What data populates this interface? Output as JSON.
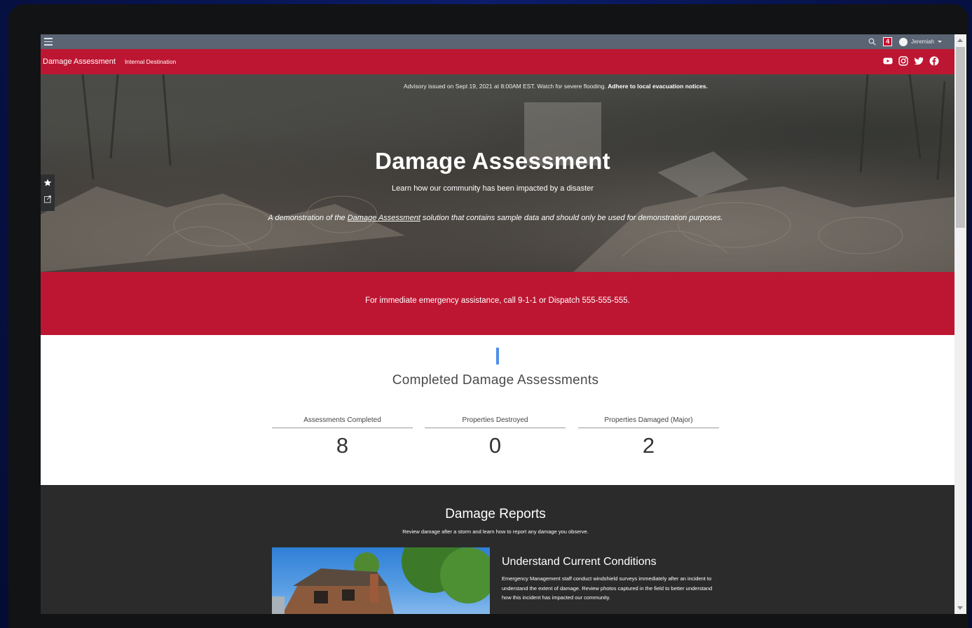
{
  "system_bar": {
    "notification_count": "4",
    "user_name": "Jeremiah"
  },
  "site_header": {
    "title": "Damage Assessment",
    "nav_link": "Internal Destination",
    "social_icons": [
      "youtube-icon",
      "instagram-icon",
      "twitter-icon",
      "facebook-icon"
    ]
  },
  "hero": {
    "advisory_text": "Advisory issued on Sept 19, 2021 at 8:00AM EST. Watch for severe flooding. ",
    "advisory_bold": "Adhere to local evacuation notices.",
    "title": "Damage Assessment",
    "subtitle": "Learn how our community has been impacted by a disaster",
    "demo_prefix": "A demonstration of the ",
    "demo_link": "Damage Assessment",
    "demo_suffix": " solution that contains sample data and should only be used for demonstration purposes."
  },
  "emergency": {
    "text": "For immediate emergency assistance, call 9-1-1 or Dispatch 555-555-555."
  },
  "stats": {
    "title": "Completed Damage Assessments",
    "items": [
      {
        "label": "Assessments Completed",
        "value": "8"
      },
      {
        "label": "Properties Destroyed",
        "value": "0"
      },
      {
        "label": "Properties Damaged (Major)",
        "value": "2"
      }
    ]
  },
  "reports": {
    "title": "Damage Reports",
    "subtitle": "Review damage after a storm and learn how to report any damage you observe.",
    "card_title": "Understand Current Conditions",
    "card_body": "Emergency Management staff conduct windshield surveys immediately after an incident to understand the extent of damage. Review photos captured in the field to better understand how this incident has impacted our community."
  },
  "colors": {
    "brand_red": "#bd1632",
    "system_bar": "#5a6473",
    "accent_blue": "#4f8fe8",
    "dark_section": "#2b2b2b"
  }
}
